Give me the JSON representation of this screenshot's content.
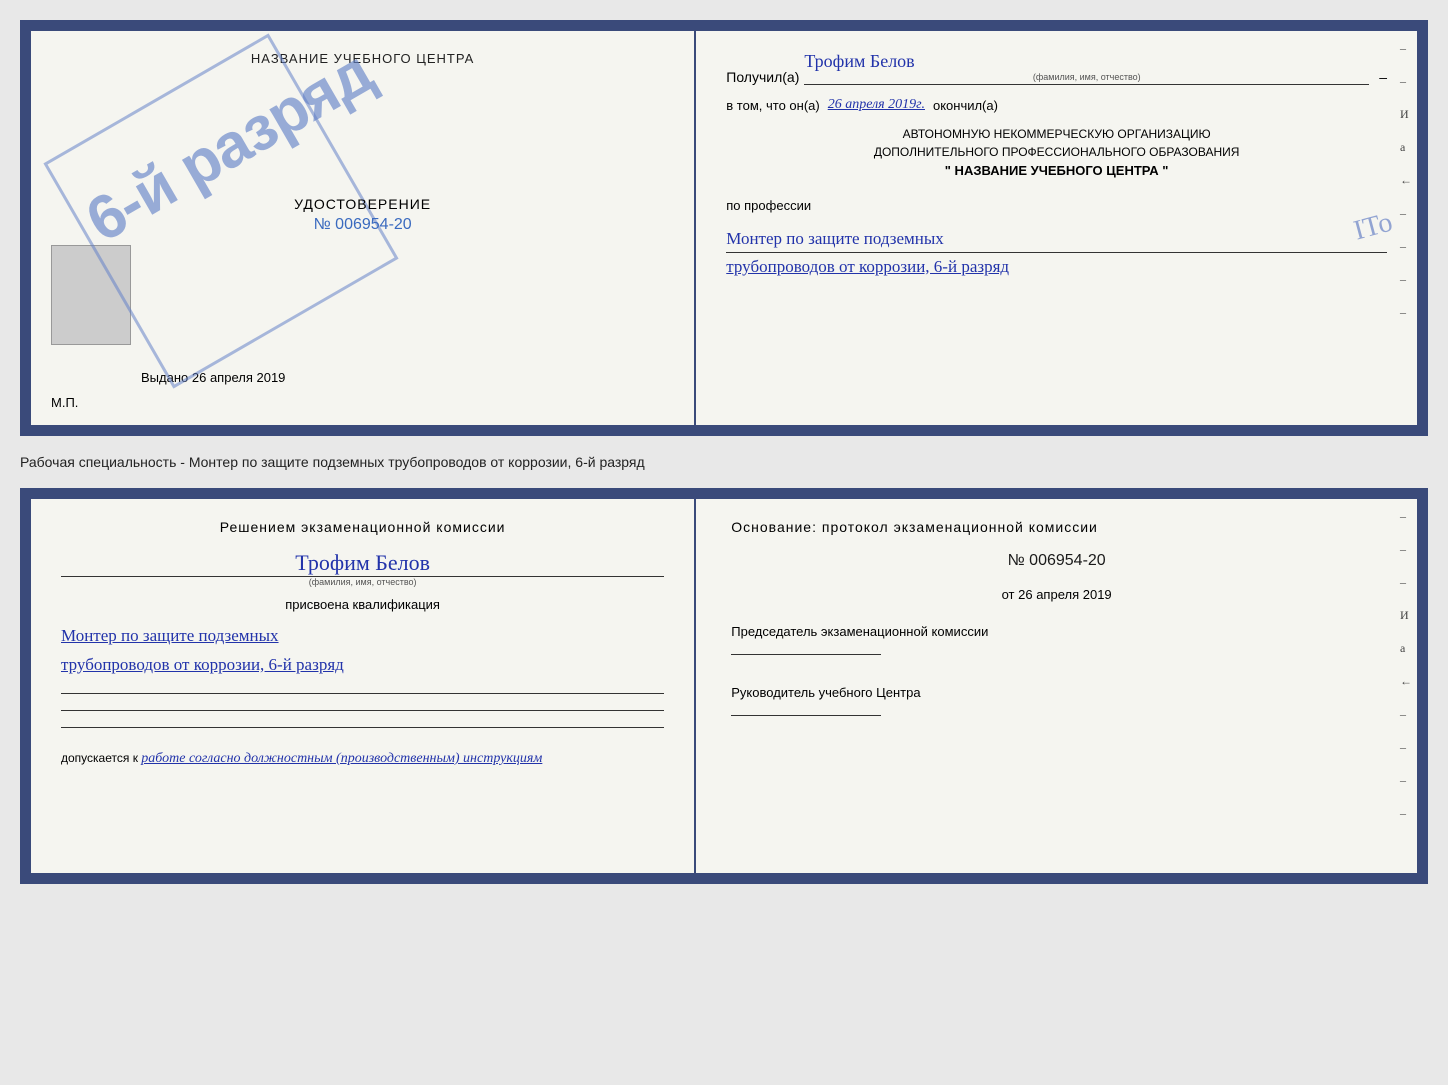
{
  "page": {
    "background_color": "#e8e8e8"
  },
  "top_cert": {
    "left": {
      "header_title": "НАЗВАНИЕ УЧЕБНОГО ЦЕНТРА",
      "stamp_text": "6-й разряд",
      "udost_label": "УДОСТОВЕРЕНИЕ",
      "udost_number": "№ 006954-20",
      "vydano_label": "Выдано",
      "vydano_date": "26 апреля 2019",
      "mp_label": "М.П."
    },
    "right": {
      "poluchil_label": "Получил(а)",
      "name_handwritten": "Трофим Белов",
      "fio_label": "(фамилия, имя, отчество)",
      "dash": "–",
      "vtom_label": "в том, что он(а)",
      "date_handwritten": "26 апреля 2019г.",
      "okonchil_label": "окончил(а)",
      "org_line1": "АВТОНОМНУЮ НЕКОММЕРЧЕСКУЮ ОРГАНИЗАЦИЮ",
      "org_line2": "ДОПОЛНИТЕЛЬНОГО ПРОФЕССИОНАЛЬНОГО ОБРАЗОВАНИЯ",
      "org_name": "\" НАЗВАНИЕ УЧЕБНОГО ЦЕНТРА \"",
      "po_professii": "по профессии",
      "profession_line1": "Монтер по защите подземных",
      "profession_line2": "трубопроводов от коррозии, 6-й разряд",
      "margin_dashes": [
        "-",
        "-",
        "И",
        "а",
        "←",
        "-",
        "-",
        "-",
        "-"
      ]
    }
  },
  "middle": {
    "text": "Рабочая специальность - Монтер по защите подземных трубопроводов от коррозии, 6-й разряд"
  },
  "bottom_cert": {
    "left": {
      "resheniem_title": "Решением экзаменационной комиссии",
      "name_handwritten": "Трофим Белов",
      "fio_label": "(фамилия, имя, отчество)",
      "prisvoena_label": "присвоена квалификация",
      "kvali_line1": "Монтер по защите подземных",
      "kvali_line2": "трубопроводов от коррозии, 6-й разряд",
      "dopusk_label": "допускается к",
      "dopusk_text": "работе согласно должностным (производственным) инструкциям"
    },
    "right": {
      "osnovanie_label": "Основание: протокол экзаменационной комиссии",
      "protocol_number": "№ 006954-20",
      "ot_label": "от",
      "protocol_date": "26 апреля 2019",
      "predsedatel_title": "Председатель экзаменационной комиссии",
      "rukovoditel_title": "Руководитель учебного Центра",
      "margin_dashes": [
        "-",
        "-",
        "-",
        "И",
        "а",
        "←",
        "-",
        "-",
        "-",
        "-"
      ]
    }
  },
  "ito_stamp": "ITo"
}
